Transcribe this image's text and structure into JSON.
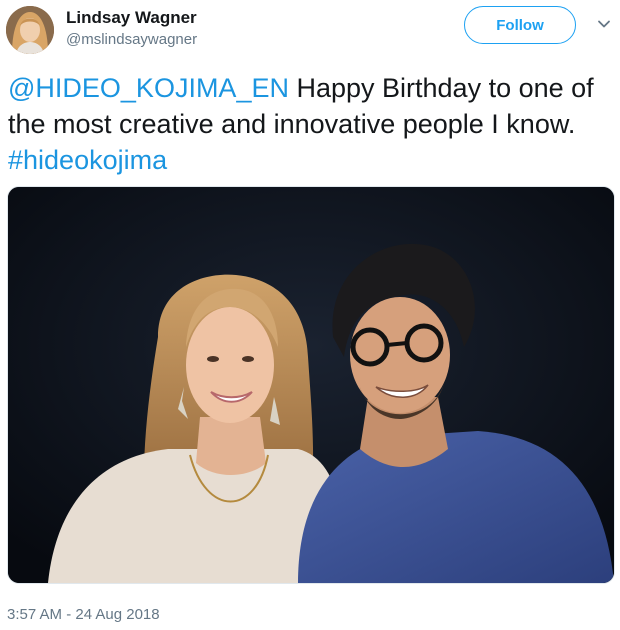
{
  "author": {
    "name": "Lindsay Wagner",
    "handle": "@mslindsaywagner"
  },
  "follow_button": {
    "label": "Follow"
  },
  "tweet": {
    "mention": "@HIDEO_KOJIMA_EN",
    "text_middle": " Happy Birthday to one of the most creative and innovative people I know. ",
    "hashtag": "#hideokojima"
  },
  "timestamp": "3:57 AM - 24 Aug 2018",
  "colors": {
    "link": "#1b95e0",
    "follow_accent": "#1da1f2",
    "secondary_text": "#657786"
  },
  "icons": {
    "menu": "chevron-down-icon"
  }
}
